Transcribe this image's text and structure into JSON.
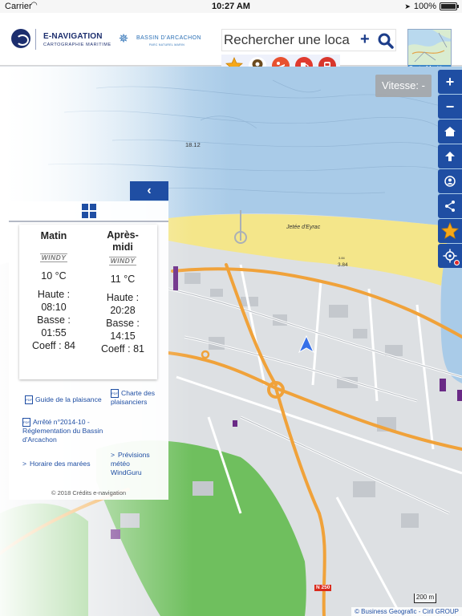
{
  "status_bar": {
    "carrier": "Carrier",
    "time": "10:27 AM",
    "battery": "100%",
    "battery_level": 1.0
  },
  "header": {
    "brand_title": "E-NAVIGATION",
    "brand_subtitle": "CARTOGRAPHIE MARITIME",
    "partner_name": "BASSIN D'ARCACHON",
    "partner_sub": "PARC NATUREL MARIN",
    "search_placeholder": "Rechercher une loca",
    "map_thumb_label": "Carte Maritime",
    "quick_icons": [
      "star-icon",
      "place-pin-icon",
      "diver-icon",
      "fuel-icon",
      "train-icon"
    ]
  },
  "map": {
    "speed_label": "Vitesse: -",
    "depth_labels": [
      "18.12",
      "3.84",
      "3.84"
    ],
    "place_label": "Jetée d'Eyrac",
    "road_label": "N 250",
    "scale_label": "200 m",
    "attribution": "© Business Geografic - Ciril GROUP"
  },
  "toolbar": [
    "plus-icon",
    "minus-icon",
    "home-icon",
    "arrow-up-icon",
    "locate-icon",
    "share-icon",
    "favorite-star-icon",
    "gps-target-icon"
  ],
  "panel": {
    "columns": [
      {
        "heading": "Matin",
        "windy": "WINDY",
        "temp": "10 °C",
        "high_label": "Haute :",
        "high_time": "08:10",
        "low_label": "Basse :",
        "low_time": "01:55",
        "coeff": "Coeff : 84"
      },
      {
        "heading": "Après-midi",
        "windy": "WINDY",
        "temp": "11 °C",
        "high_label": "Haute :",
        "high_time": "20:28",
        "low_label": "Basse :",
        "low_time": "14:15",
        "coeff": "Coeff : 81"
      }
    ],
    "links": {
      "guide": "Guide de la plaisance",
      "charte": "Charte des plaisanciers",
      "arrete": "Arrêté n°2014-10 - Réglementation du Bassin d'Arcachon",
      "marees": "Horaire des marées",
      "meteo": "Prévisions météo WindGuru"
    },
    "credits": "© 2018 Crédits e-navigation"
  },
  "colors": {
    "accent": "#1f4ea3",
    "sea": "#a9cbe8",
    "beach": "#f4e68a",
    "park": "#6fbf5e",
    "road": "#f0a23a"
  }
}
